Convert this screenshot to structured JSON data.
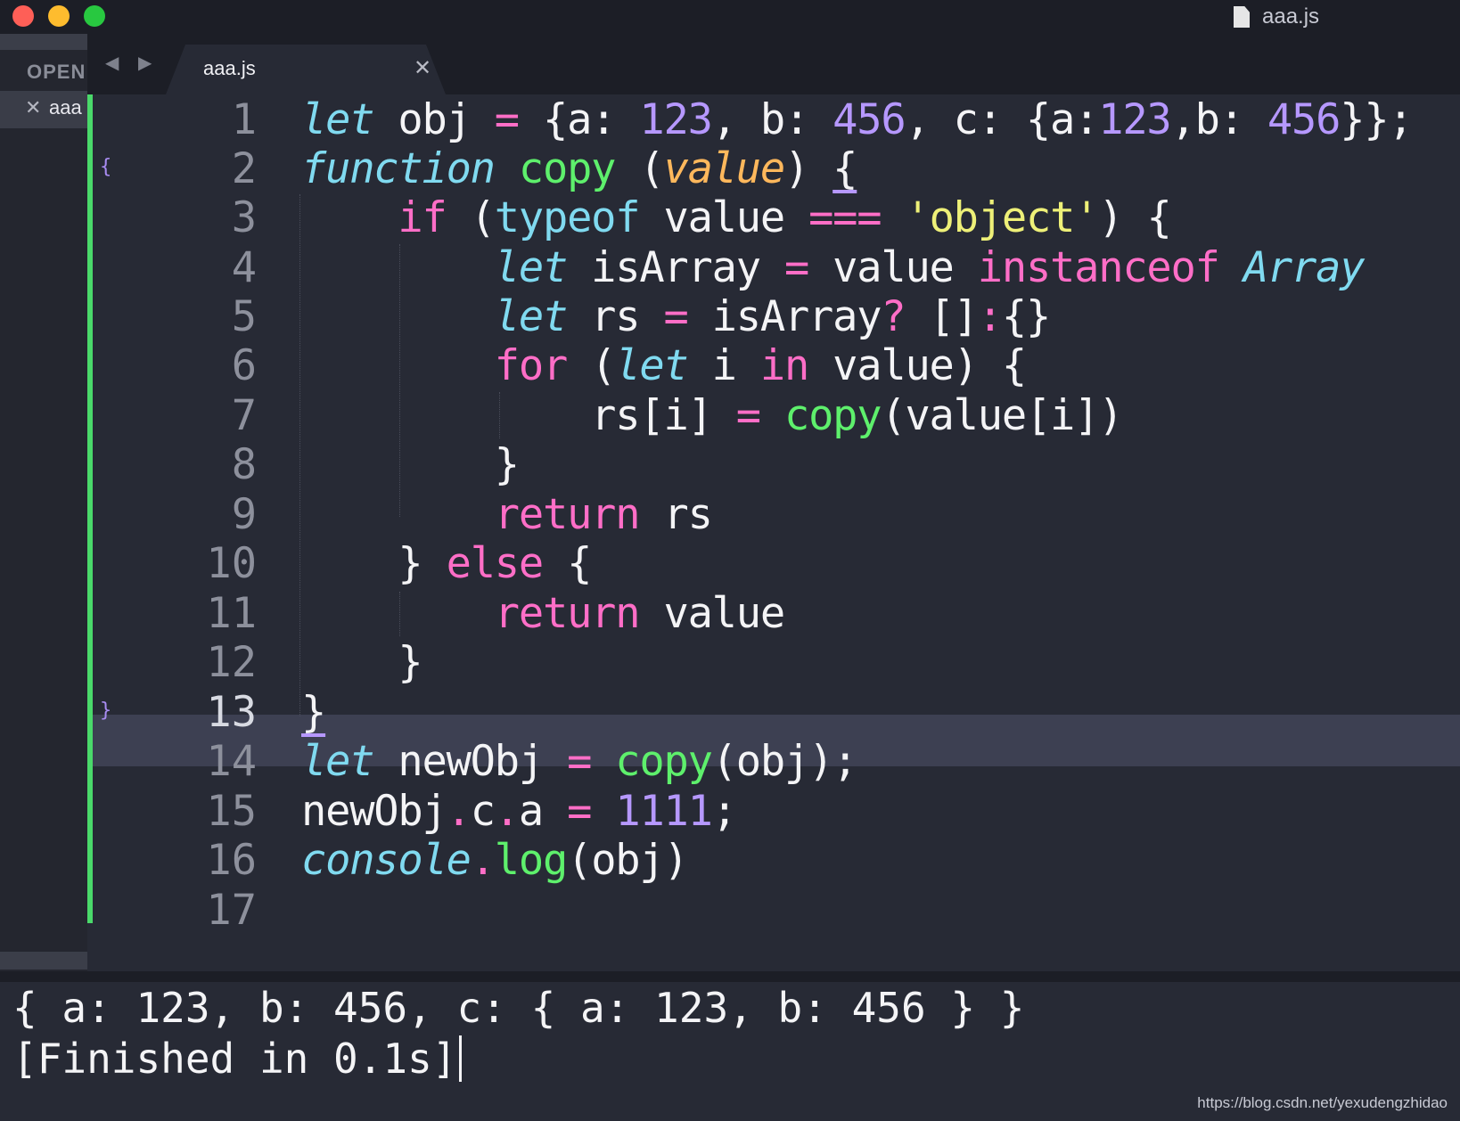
{
  "window": {
    "title": "aaa.js",
    "colors": {
      "close": "#fe5f57",
      "minimize": "#febc2e",
      "zoom": "#28c840"
    }
  },
  "sidebar": {
    "header": "OPEN",
    "open_file_close": "✕",
    "open_file_name": "aaa"
  },
  "tabbar": {
    "nav_arrows": "◀ ▶",
    "tab_label": "aaa.js",
    "tab_close": "✕"
  },
  "editor": {
    "current_line": 13,
    "fold_open": "{",
    "fold_close": "}",
    "line_numbers": [
      "1",
      "2",
      "3",
      "4",
      "5",
      "6",
      "7",
      "8",
      "9",
      "10",
      "11",
      "12",
      "13",
      "14",
      "15",
      "16",
      "17"
    ],
    "colors": {
      "keyword": "#ff6ec7",
      "storage": "#80daf0",
      "function": "#5ef06c",
      "number": "#b698ff",
      "string": "#eef078",
      "parameter": "#ffb85c",
      "text": "#f4f4f6",
      "modified_marker": "#4ad96a"
    }
  },
  "output": {
    "lines": [
      "{ a: 123, b: 456, c: { a: 123, b: 456 } }",
      "[Finished in 0.1s]"
    ]
  },
  "watermark": "https://blog.csdn.net/yexudengzhidao"
}
